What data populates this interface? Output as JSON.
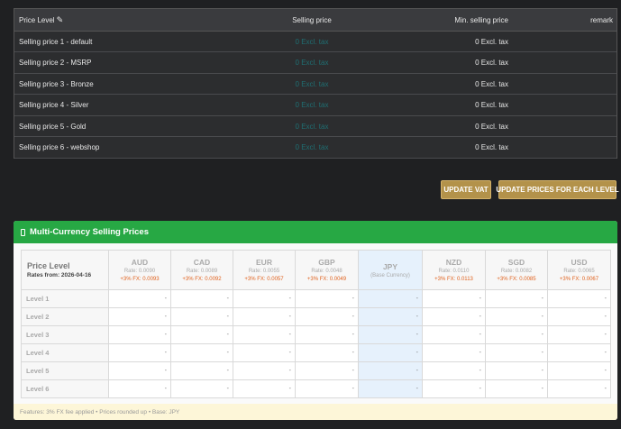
{
  "price_table": {
    "headers": {
      "level": "Price Level",
      "selling": "Selling price",
      "min": "Min. selling price",
      "remark": "remark"
    },
    "rows": [
      {
        "level": "Selling price 1 - default",
        "selling": "0 Excl. tax",
        "min": "0 Excl. tax"
      },
      {
        "level": "Selling price 2 - MSRP",
        "selling": "0 Excl. tax",
        "min": "0 Excl. tax"
      },
      {
        "level": "Selling price 3 - Bronze",
        "selling": "0 Excl. tax",
        "min": "0 Excl. tax"
      },
      {
        "level": "Selling price 4 - Silver",
        "selling": "0 Excl. tax",
        "min": "0 Excl. tax"
      },
      {
        "level": "Selling price 5 - Gold",
        "selling": "0 Excl. tax",
        "min": "0 Excl. tax"
      },
      {
        "level": "Selling price 6 - webshop",
        "selling": "0 Excl. tax",
        "min": "0 Excl. tax"
      }
    ]
  },
  "buttons": {
    "update_vat": "UPDATE VAT",
    "update_levels": "UPDATE PRICES FOR EACH LEVEL"
  },
  "multi_currency": {
    "title": "Multi-Currency Selling Prices",
    "corner": {
      "title": "Price Level",
      "rates_from": "Rates from: 2026-04-16"
    },
    "currencies": [
      {
        "code": "AUD",
        "rate": "Rate: 0.0090",
        "fx": "+3% FX: 0.0093"
      },
      {
        "code": "CAD",
        "rate": "Rate: 0.0089",
        "fx": "+3% FX: 0.0092"
      },
      {
        "code": "EUR",
        "rate": "Rate: 0.0055",
        "fx": "+3% FX: 0.0057"
      },
      {
        "code": "GBP",
        "rate": "Rate: 0.0048",
        "fx": "+3% FX: 0.0049"
      },
      {
        "code": "JPY",
        "rate": "(Base Currency)",
        "fx": ""
      },
      {
        "code": "NZD",
        "rate": "Rate: 0.0110",
        "fx": "+3% FX: 0.0113"
      },
      {
        "code": "SGD",
        "rate": "Rate: 0.0082",
        "fx": "+3% FX: 0.0085"
      },
      {
        "code": "USD",
        "rate": "Rate: 0.0065",
        "fx": "+3% FX: 0.0067"
      }
    ],
    "levels": [
      "Level 1",
      "Level 2",
      "Level 3",
      "Level 4",
      "Level 5",
      "Level 6"
    ],
    "cell_value": "-",
    "footer": "Features: 3% FX fee applied • Prices rounded up • Base: JPY"
  }
}
